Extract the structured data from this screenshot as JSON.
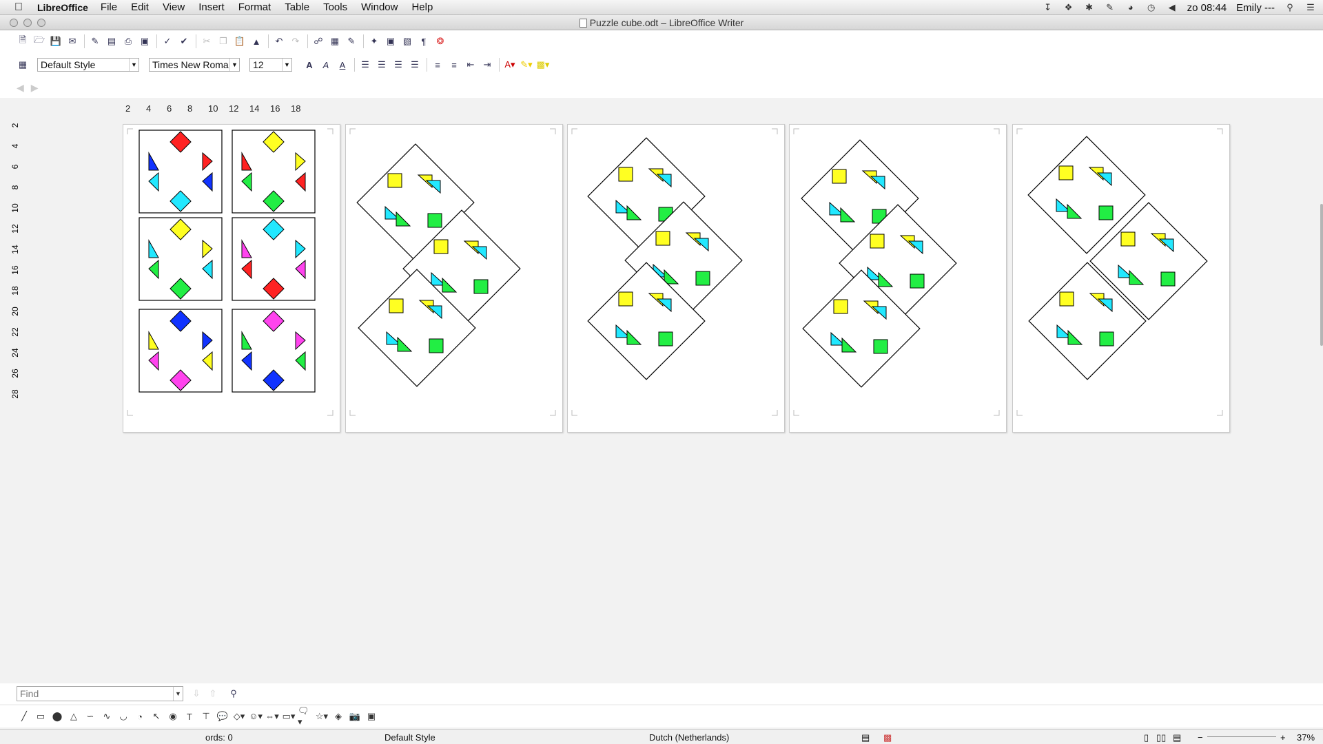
{
  "menubar": {
    "app_name": "LibreOffice",
    "menus": [
      "File",
      "Edit",
      "View",
      "Insert",
      "Format",
      "Table",
      "Tools",
      "Window",
      "Help"
    ],
    "clock": "zo 08:44",
    "user": "Emily ---"
  },
  "window": {
    "title": "Puzzle cube.odt – LibreOffice Writer"
  },
  "formatting": {
    "paragraph_style": "Default Style",
    "font_name": "Times New Roma",
    "font_size": "12"
  },
  "ruler": {
    "horizontal_ticks": [
      "2",
      "4",
      "6",
      "8",
      "10",
      "12",
      "14",
      "16",
      "18"
    ],
    "vertical_ticks": [
      "2",
      "4",
      "6",
      "8",
      "10",
      "12",
      "14",
      "16",
      "18",
      "20",
      "22",
      "24",
      "26",
      "28"
    ]
  },
  "find": {
    "placeholder": "Find"
  },
  "status": {
    "words": "ords: 0",
    "page_style": "Default Style",
    "language": "Dutch (Netherlands)",
    "zoom": "37%"
  },
  "colors": {
    "red": "#ff2222",
    "yellow": "#ffff22",
    "cyan": "#22e8ff",
    "green": "#22ee44",
    "blue": "#1133ff",
    "magenta": "#ff44ee"
  },
  "icons": {
    "standard_toolbar": [
      "new-document-icon",
      "open-icon",
      "save-icon",
      "email-icon",
      "edit-mode-icon",
      "export-pdf-icon",
      "print-icon",
      "print-preview-icon",
      "spellcheck-icon",
      "autospell-icon",
      "cut-icon",
      "copy-icon",
      "paste-icon",
      "clone-format-icon",
      "undo-icon",
      "redo-icon",
      "hyperlink-icon",
      "table-icon",
      "show-draw-icon",
      "navigator-icon",
      "gallery-icon",
      "data-sources-icon",
      "formatting-marks-icon",
      "help-icon"
    ],
    "draw_toolbar": [
      "line-icon",
      "rectangle-icon",
      "ellipse-icon",
      "polygon-icon",
      "curve-icon",
      "freeform-icon",
      "arc-icon",
      "circle-pie-icon",
      "select-icon",
      "fill-icon",
      "text-icon",
      "vertical-text-icon",
      "callout-icon",
      "basic-shapes-icon",
      "symbol-shapes-icon",
      "block-arrows-icon",
      "flowchart-icon",
      "callouts-icon",
      "stars-icon",
      "points-icon",
      "image-icon",
      "extrusion-icon"
    ]
  }
}
